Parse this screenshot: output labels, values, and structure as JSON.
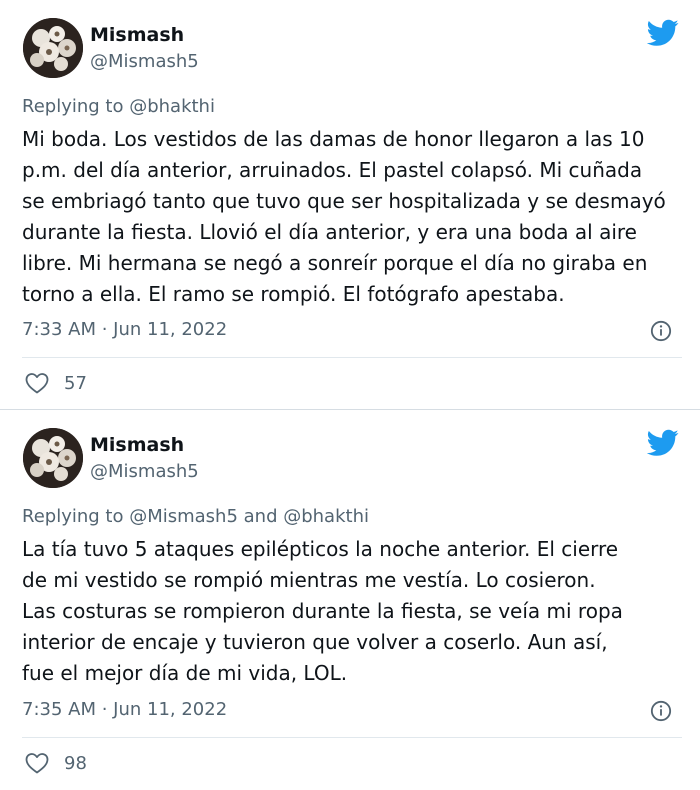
{
  "brand_color": "#1d9bf0",
  "tweets": [
    {
      "name": "Mismash",
      "handle": "@Mismash5",
      "reply_prefix": "Replying to ",
      "reply_targets": "@bhakthi",
      "body_lines": [
        "Mi boda. Los vestidos de las damas de honor llegaron a las 10",
        "p.m. del día anterior, arruinados. El pastel colapsó. Mi cuñada",
        "se embriagó tanto que tuvo que ser hospitalizada y se desmayó",
        "durante la fiesta. Llovió el día anterior, y era una boda al aire",
        "libre. Mi hermana se negó a sonreír porque el día no giraba en",
        "torno a ella. El ramo se rompió. El fotógrafo apestaba."
      ],
      "timestamp": "7:33 AM · Jun 11, 2022",
      "likes": "57",
      "icons": {
        "logo": "twitter-bird-icon",
        "info": "info-icon",
        "like": "heart-icon"
      }
    },
    {
      "name": "Mismash",
      "handle": "@Mismash5",
      "reply_prefix": "Replying to ",
      "reply_targets": "@Mismash5 and @bhakthi",
      "body_lines": [
        "La tía tuvo 5 ataques epilépticos la noche anterior. El cierre",
        "de mi vestido se rompió mientras me vestía. Lo cosieron.",
        "Las costuras se rompieron durante la fiesta, se veía mi ropa",
        "interior de encaje y tuvieron que volver a coserlo. Aun así,",
        "fue el mejor día de mi vida, LOL."
      ],
      "timestamp": "7:35 AM · Jun 11, 2022",
      "likes": "98",
      "icons": {
        "logo": "twitter-bird-icon",
        "info": "info-icon",
        "like": "heart-icon"
      }
    }
  ]
}
